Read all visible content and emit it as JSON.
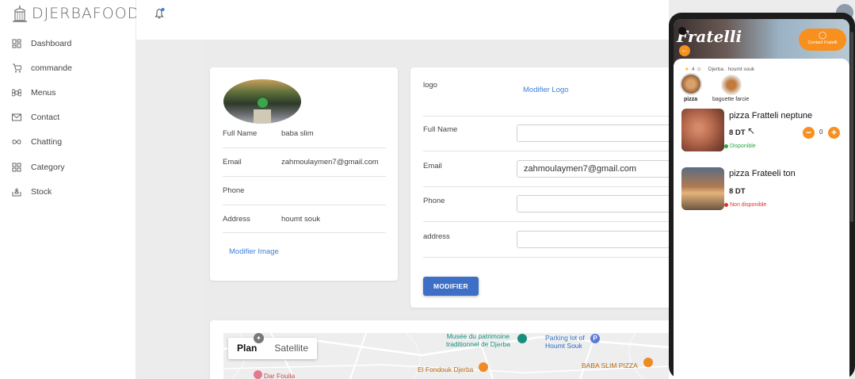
{
  "app": {
    "brand": "DJERBAFOOD"
  },
  "sidebar": {
    "items": [
      {
        "label": "Dashboard",
        "icon": "dashboard-grid-icon"
      },
      {
        "label": "commande",
        "icon": "cart-icon"
      },
      {
        "label": "Menus",
        "icon": "command-icon"
      },
      {
        "label": "Contact",
        "icon": "mail-icon"
      },
      {
        "label": "Chatting",
        "icon": "infinity-icon"
      },
      {
        "label": "Category",
        "icon": "category-grid-icon"
      },
      {
        "label": "Stock",
        "icon": "stock-box-icon"
      }
    ]
  },
  "profile": {
    "full_name_label": "Full Name",
    "full_name": "baba slim",
    "email_label": "Email",
    "email": "zahmoulaymen7@gmail.com",
    "phone_label": "Phone",
    "phone": "",
    "address_label": "Address",
    "address": "houmt souk",
    "modify_image": "Modifier Image"
  },
  "form": {
    "logo_label": "logo",
    "modify_logo": "Modifier Logo",
    "full_name_label": "Full Name",
    "full_name_value": "",
    "email_label": "Email",
    "email_value": "zahmoulaymen7@gmail.com",
    "phone_label": "Phone",
    "phone_value": "",
    "address_label": "address",
    "address_value": "",
    "submit": "MODIFIER"
  },
  "map": {
    "tabs": [
      "Plan",
      "Satellite"
    ],
    "pois": [
      "Musée du patrimoine\ntraditionnel de Djerba",
      "Parking lot of\nHoumt Souk",
      "El Fondouk Djerba",
      "BABA SLIM PIZZA",
      "Dar Fouila"
    ]
  },
  "phone": {
    "restaurant_name": "Fratelli",
    "contact_button": "Contact Fratelli",
    "rating": "4",
    "location": "Djerba . houmt souk",
    "categories": [
      {
        "label": "pizza",
        "active": true
      },
      {
        "label": "baguette farcie",
        "active": false
      }
    ],
    "dishes": [
      {
        "name": "pizza Fratteli neptune",
        "price": "8 DT",
        "status": "Disponible",
        "status_color": "#27a844",
        "qty": "0"
      },
      {
        "name": "pizza Frateeli ton",
        "price": "8 DT",
        "status": "Non disponible",
        "status_color": "#e03131"
      }
    ]
  },
  "colors": {
    "accent": "#3d6fc7",
    "link": "#3f7fd9",
    "orange": "#f7901e"
  }
}
